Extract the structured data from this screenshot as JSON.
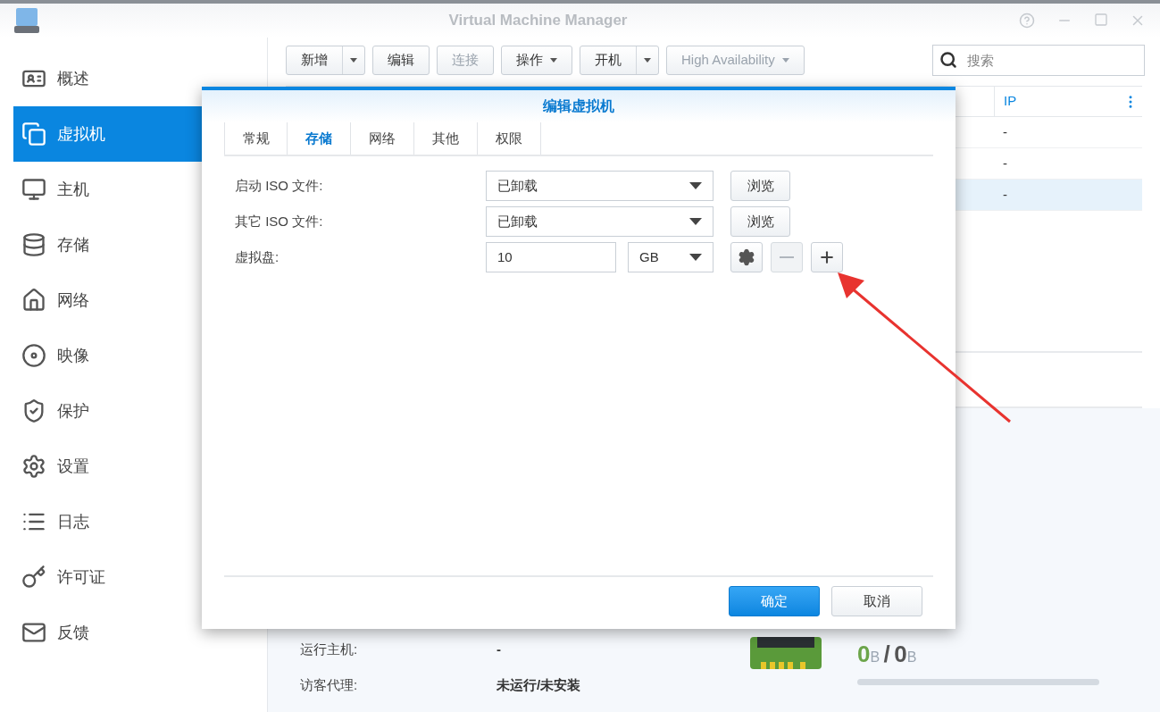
{
  "window": {
    "title": "Virtual Machine Manager"
  },
  "sidebar": {
    "items": [
      {
        "label": "概述",
        "selected": false
      },
      {
        "label": "虚拟机",
        "selected": true
      },
      {
        "label": "主机",
        "selected": false
      },
      {
        "label": "存储",
        "selected": false
      },
      {
        "label": "网络",
        "selected": false
      },
      {
        "label": "映像",
        "selected": false
      },
      {
        "label": "保护",
        "selected": false
      },
      {
        "label": "设置",
        "selected": false
      },
      {
        "label": "日志",
        "selected": false
      },
      {
        "label": "许可证",
        "selected": false
      },
      {
        "label": "反馈",
        "selected": false
      }
    ]
  },
  "toolbar": {
    "buttons": [
      {
        "label": "新增",
        "kind": "split",
        "disabled": false
      },
      {
        "label": "编辑",
        "kind": "plain",
        "disabled": false
      },
      {
        "label": "连接",
        "kind": "plain",
        "disabled": true
      },
      {
        "label": "操作",
        "kind": "menu",
        "disabled": false
      },
      {
        "label": "开机",
        "kind": "split",
        "disabled": false
      },
      {
        "label": "High Availability",
        "kind": "menu",
        "disabled": true
      }
    ]
  },
  "search": {
    "placeholder": "搜索"
  },
  "table": {
    "columns": [
      "IP"
    ],
    "rows": [
      {
        "cells": [
          "-"
        ],
        "selected": false
      },
      {
        "cells": [
          "-"
        ],
        "selected": false
      },
      {
        "cells": [
          "-"
        ],
        "selected": true
      }
    ]
  },
  "details": {
    "rows": [
      {
        "label": "运行主机:",
        "value": "-"
      },
      {
        "label": "访客代理:",
        "value": "未运行/未安装"
      }
    ],
    "memory": {
      "used": "0",
      "used_unit": "B",
      "separator": "/",
      "total": "0",
      "total_unit": "B"
    }
  },
  "dialog": {
    "title": "编辑虚拟机",
    "tabs": [
      {
        "label": "常规",
        "selected": false
      },
      {
        "label": "存储",
        "selected": true
      },
      {
        "label": "网络",
        "selected": false
      },
      {
        "label": "其他",
        "selected": false
      },
      {
        "label": "权限",
        "selected": false
      }
    ],
    "fields": [
      {
        "kind": "iso",
        "label": "启动 ISO 文件:",
        "value": "已卸载",
        "button": "浏览"
      },
      {
        "kind": "iso",
        "label": "其它 ISO 文件:",
        "value": "已卸载",
        "button": "浏览"
      },
      {
        "kind": "disk",
        "label": "虚拟盘:",
        "value": "10",
        "unit": "GB"
      }
    ],
    "buttons": [
      {
        "label": "确定",
        "primary": true
      },
      {
        "label": "取消",
        "primary": false
      }
    ]
  }
}
